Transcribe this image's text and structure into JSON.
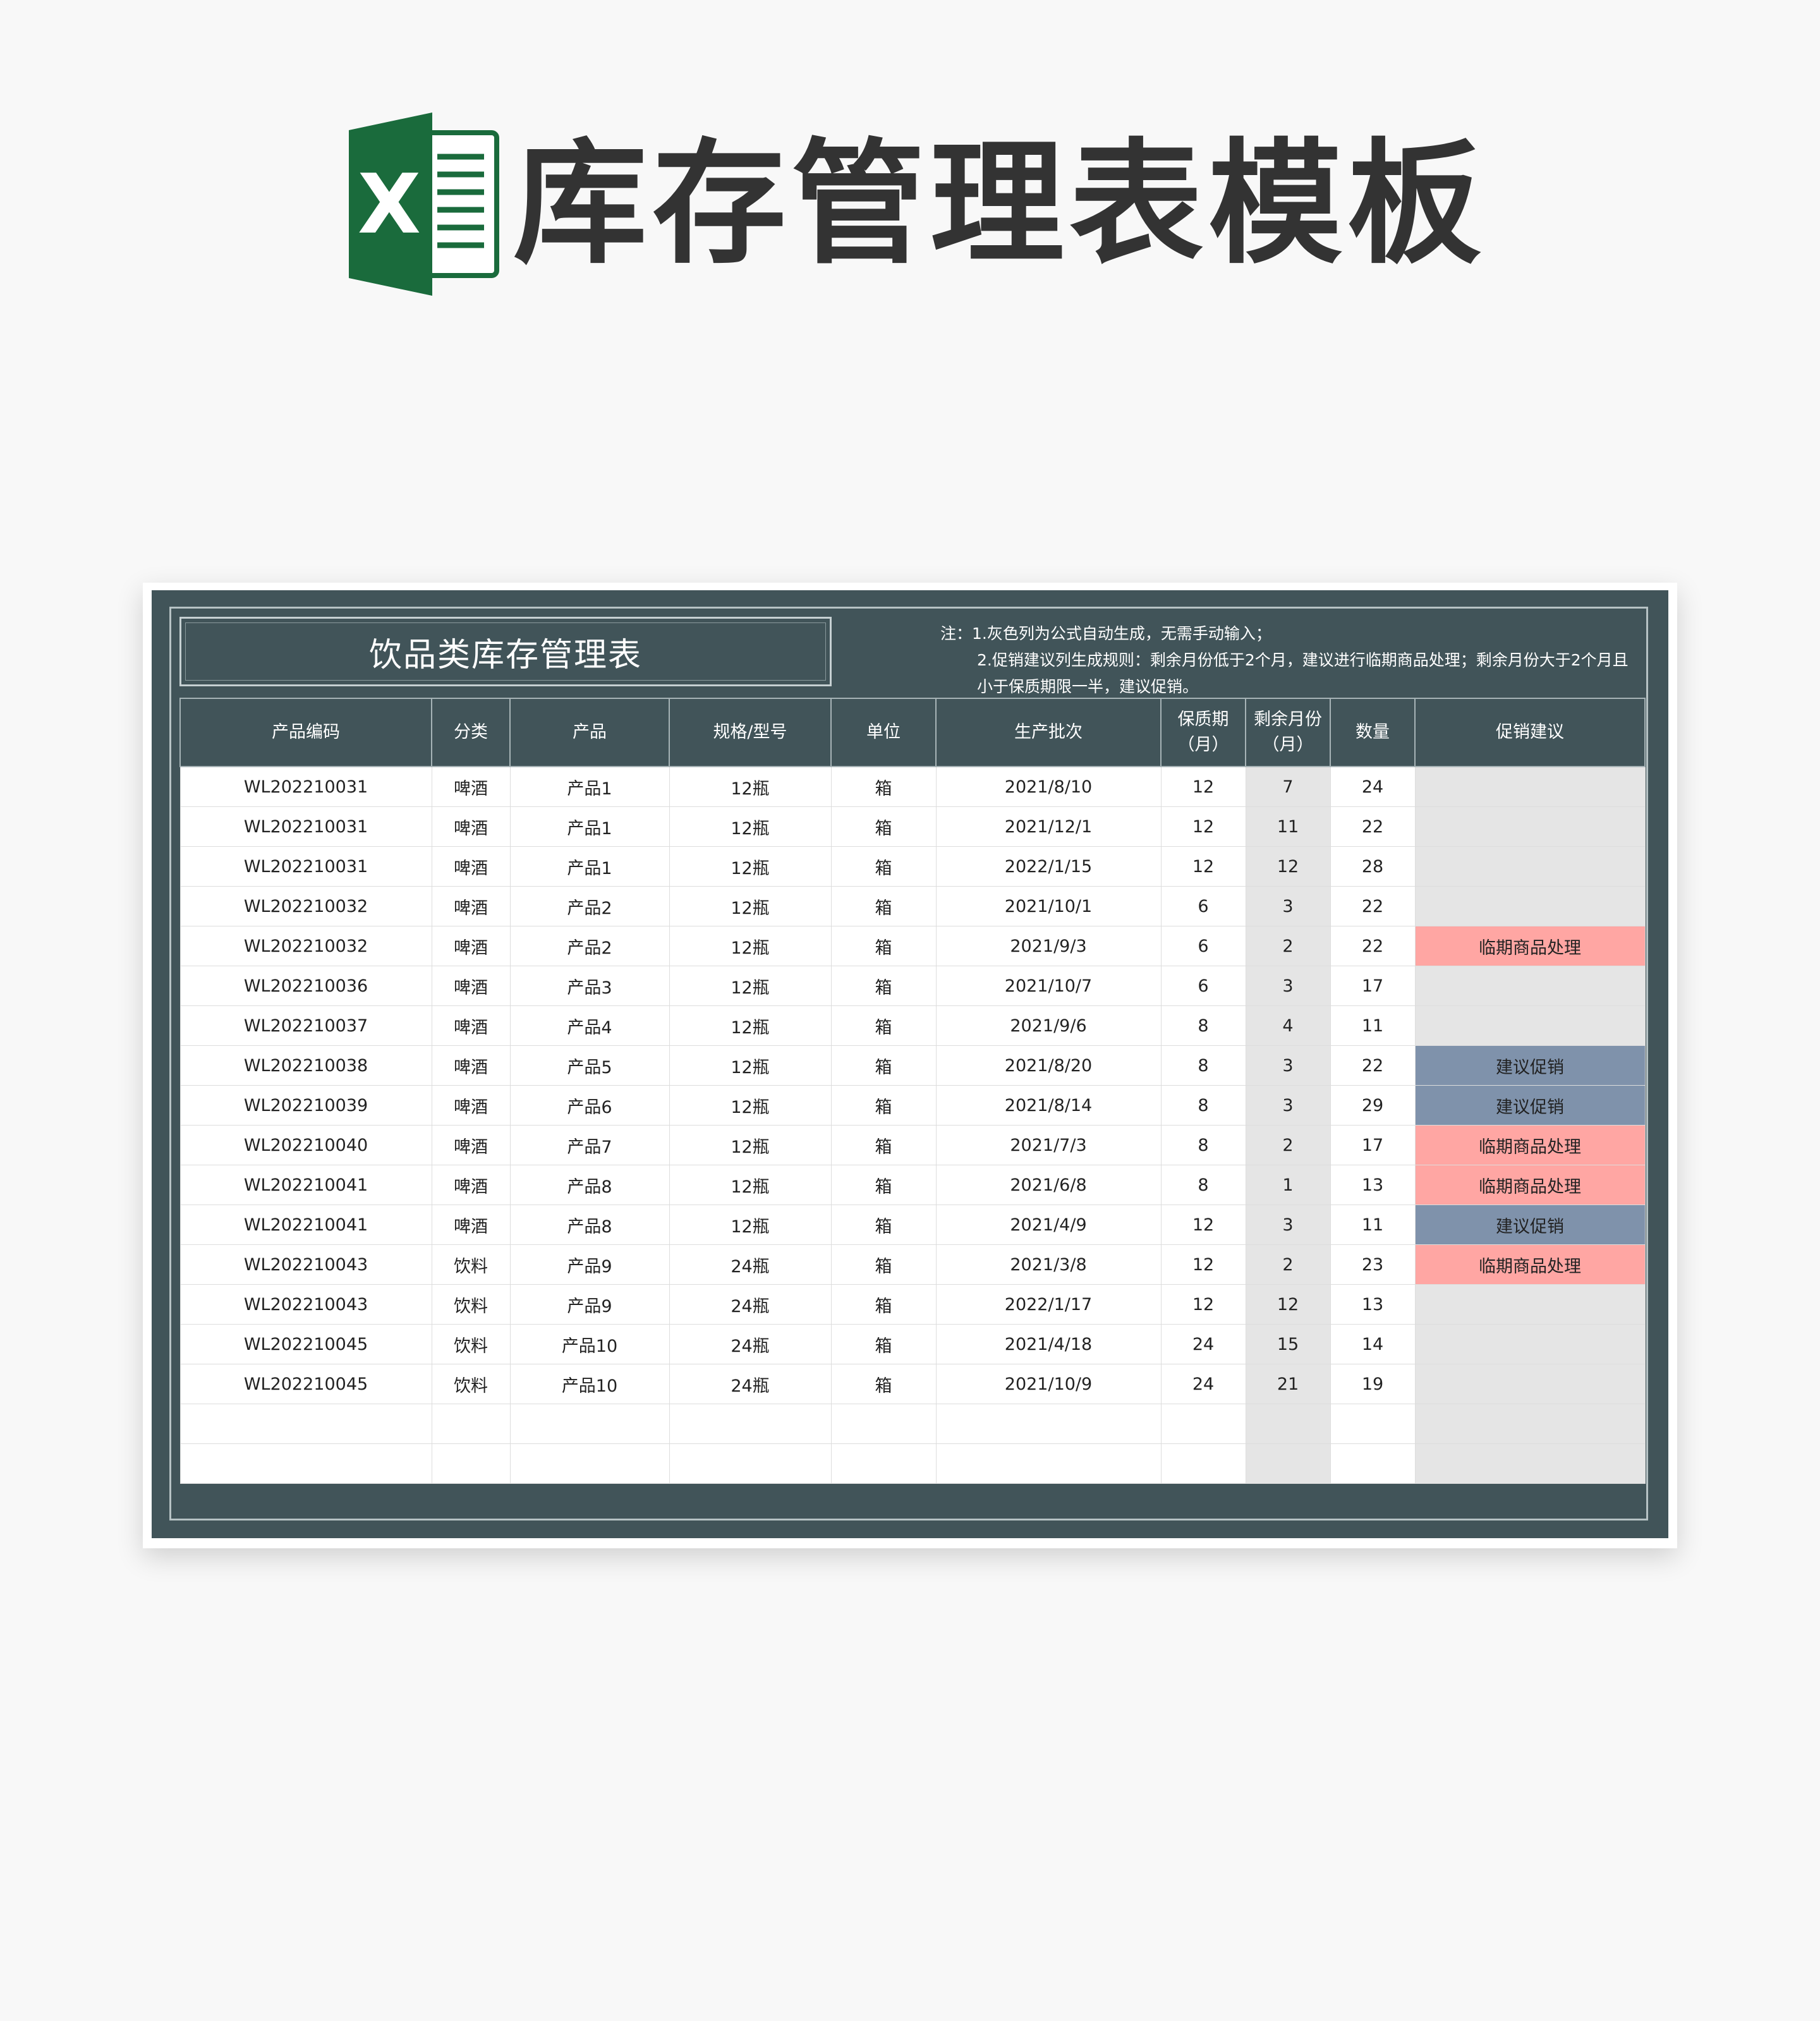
{
  "hero": {
    "title": "库存管理表模板",
    "logo_letter": "X"
  },
  "sheet": {
    "title": "饮品类库存管理表",
    "notes": [
      "注：1.灰色列为公式自动生成，无需手动输入；",
      "2.促销建议列生成规则：剩余月份低于2个月，建议进行临期商品处理；剩余月份大于2个月且小于保质期限一半，建议促销。"
    ],
    "columns": [
      "产品编码",
      "分类",
      "产品",
      "规格/型号",
      "单位",
      "生产批次",
      "保质期（月）",
      "剩余月份（月）",
      "数量",
      "促销建议"
    ],
    "rows": [
      {
        "code": "WL202210031",
        "category": "啤酒",
        "product": "产品1",
        "spec": "12瓶",
        "unit": "箱",
        "batch": "2021/8/10",
        "shelf": "12",
        "remain": "7",
        "qty": "24",
        "advice": "",
        "advice_type": "none"
      },
      {
        "code": "WL202210031",
        "category": "啤酒",
        "product": "产品1",
        "spec": "12瓶",
        "unit": "箱",
        "batch": "2021/12/1",
        "shelf": "12",
        "remain": "11",
        "qty": "22",
        "advice": "",
        "advice_type": "none"
      },
      {
        "code": "WL202210031",
        "category": "啤酒",
        "product": "产品1",
        "spec": "12瓶",
        "unit": "箱",
        "batch": "2022/1/15",
        "shelf": "12",
        "remain": "12",
        "qty": "28",
        "advice": "",
        "advice_type": "none"
      },
      {
        "code": "WL202210032",
        "category": "啤酒",
        "product": "产品2",
        "spec": "12瓶",
        "unit": "箱",
        "batch": "2021/10/1",
        "shelf": "6",
        "remain": "3",
        "qty": "22",
        "advice": "",
        "advice_type": "none"
      },
      {
        "code": "WL202210032",
        "category": "啤酒",
        "product": "产品2",
        "spec": "12瓶",
        "unit": "箱",
        "batch": "2021/9/3",
        "shelf": "6",
        "remain": "2",
        "qty": "22",
        "advice": "临期商品处理",
        "advice_type": "expiring"
      },
      {
        "code": "WL202210036",
        "category": "啤酒",
        "product": "产品3",
        "spec": "12瓶",
        "unit": "箱",
        "batch": "2021/10/7",
        "shelf": "6",
        "remain": "3",
        "qty": "17",
        "advice": "",
        "advice_type": "none"
      },
      {
        "code": "WL202210037",
        "category": "啤酒",
        "product": "产品4",
        "spec": "12瓶",
        "unit": "箱",
        "batch": "2021/9/6",
        "shelf": "8",
        "remain": "4",
        "qty": "11",
        "advice": "",
        "advice_type": "none"
      },
      {
        "code": "WL202210038",
        "category": "啤酒",
        "product": "产品5",
        "spec": "12瓶",
        "unit": "箱",
        "batch": "2021/8/20",
        "shelf": "8",
        "remain": "3",
        "qty": "22",
        "advice": "建议促销",
        "advice_type": "promote"
      },
      {
        "code": "WL202210039",
        "category": "啤酒",
        "product": "产品6",
        "spec": "12瓶",
        "unit": "箱",
        "batch": "2021/8/14",
        "shelf": "8",
        "remain": "3",
        "qty": "29",
        "advice": "建议促销",
        "advice_type": "promote"
      },
      {
        "code": "WL202210040",
        "category": "啤酒",
        "product": "产品7",
        "spec": "12瓶",
        "unit": "箱",
        "batch": "2021/7/3",
        "shelf": "8",
        "remain": "2",
        "qty": "17",
        "advice": "临期商品处理",
        "advice_type": "expiring"
      },
      {
        "code": "WL202210041",
        "category": "啤酒",
        "product": "产品8",
        "spec": "12瓶",
        "unit": "箱",
        "batch": "2021/6/8",
        "shelf": "8",
        "remain": "1",
        "qty": "13",
        "advice": "临期商品处理",
        "advice_type": "expiring"
      },
      {
        "code": "WL202210041",
        "category": "啤酒",
        "product": "产品8",
        "spec": "12瓶",
        "unit": "箱",
        "batch": "2021/4/9",
        "shelf": "12",
        "remain": "3",
        "qty": "11",
        "advice": "建议促销",
        "advice_type": "promote"
      },
      {
        "code": "WL202210043",
        "category": "饮料",
        "product": "产品9",
        "spec": "24瓶",
        "unit": "箱",
        "batch": "2021/3/8",
        "shelf": "12",
        "remain": "2",
        "qty": "23",
        "advice": "临期商品处理",
        "advice_type": "expiring"
      },
      {
        "code": "WL202210043",
        "category": "饮料",
        "product": "产品9",
        "spec": "24瓶",
        "unit": "箱",
        "batch": "2022/1/17",
        "shelf": "12",
        "remain": "12",
        "qty": "13",
        "advice": "",
        "advice_type": "none"
      },
      {
        "code": "WL202210045",
        "category": "饮料",
        "product": "产品10",
        "spec": "24瓶",
        "unit": "箱",
        "batch": "2021/4/18",
        "shelf": "24",
        "remain": "15",
        "qty": "14",
        "advice": "",
        "advice_type": "none"
      },
      {
        "code": "WL202210045",
        "category": "饮料",
        "product": "产品10",
        "spec": "24瓶",
        "unit": "箱",
        "batch": "2021/10/9",
        "shelf": "24",
        "remain": "21",
        "qty": "19",
        "advice": "",
        "advice_type": "none"
      },
      {
        "code": "",
        "category": "",
        "product": "",
        "spec": "",
        "unit": "",
        "batch": "",
        "shelf": "",
        "remain": "",
        "qty": "",
        "advice": "",
        "advice_type": "none"
      },
      {
        "code": "",
        "category": "",
        "product": "",
        "spec": "",
        "unit": "",
        "batch": "",
        "shelf": "",
        "remain": "",
        "qty": "",
        "advice": "",
        "advice_type": "none"
      }
    ]
  },
  "colors": {
    "frame": "#415459",
    "excel_green": "#1a6b3c",
    "gray_column": "#e5e5e5",
    "expiring": "#ffa6a3",
    "promote": "#7f92ab"
  }
}
